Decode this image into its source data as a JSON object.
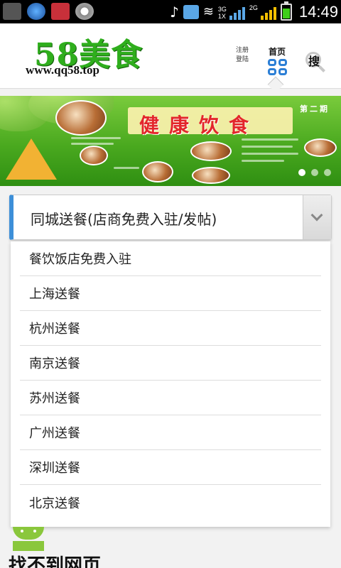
{
  "status_bar": {
    "time": "14:49",
    "network_3g_label": "3G",
    "network_1x_label": "1X",
    "network_2g_label": "2G",
    "icons": [
      "gallery-icon",
      "app-icon",
      "shield-icon",
      "sync-icon",
      "music-muted-icon",
      "volume-icon",
      "wifi-icon",
      "signal-3g-icon",
      "signal-2g-icon",
      "battery-icon"
    ]
  },
  "header": {
    "logo_title": "58美食",
    "logo_url": "www.qq58.top",
    "nav_register": "注册",
    "nav_login": "登陆",
    "nav_home": "首页",
    "nav_search": "搜"
  },
  "banner": {
    "title": "健康饮食",
    "issue": "第二期"
  },
  "select": {
    "selected_value": "同城送餐(店商免费入驻/发帖)",
    "options": [
      "餐饮饭店免费入驻",
      "上海送餐",
      "杭州送餐",
      "南京送餐",
      "苏州送餐",
      "广州送餐",
      "深圳送餐",
      "北京送餐"
    ]
  },
  "error_page": {
    "title": "找不到网页"
  },
  "colors": {
    "accent_blue": "#3d8fd8",
    "logo_green": "#2fae1d",
    "banner_title_red": "#e3262b"
  }
}
